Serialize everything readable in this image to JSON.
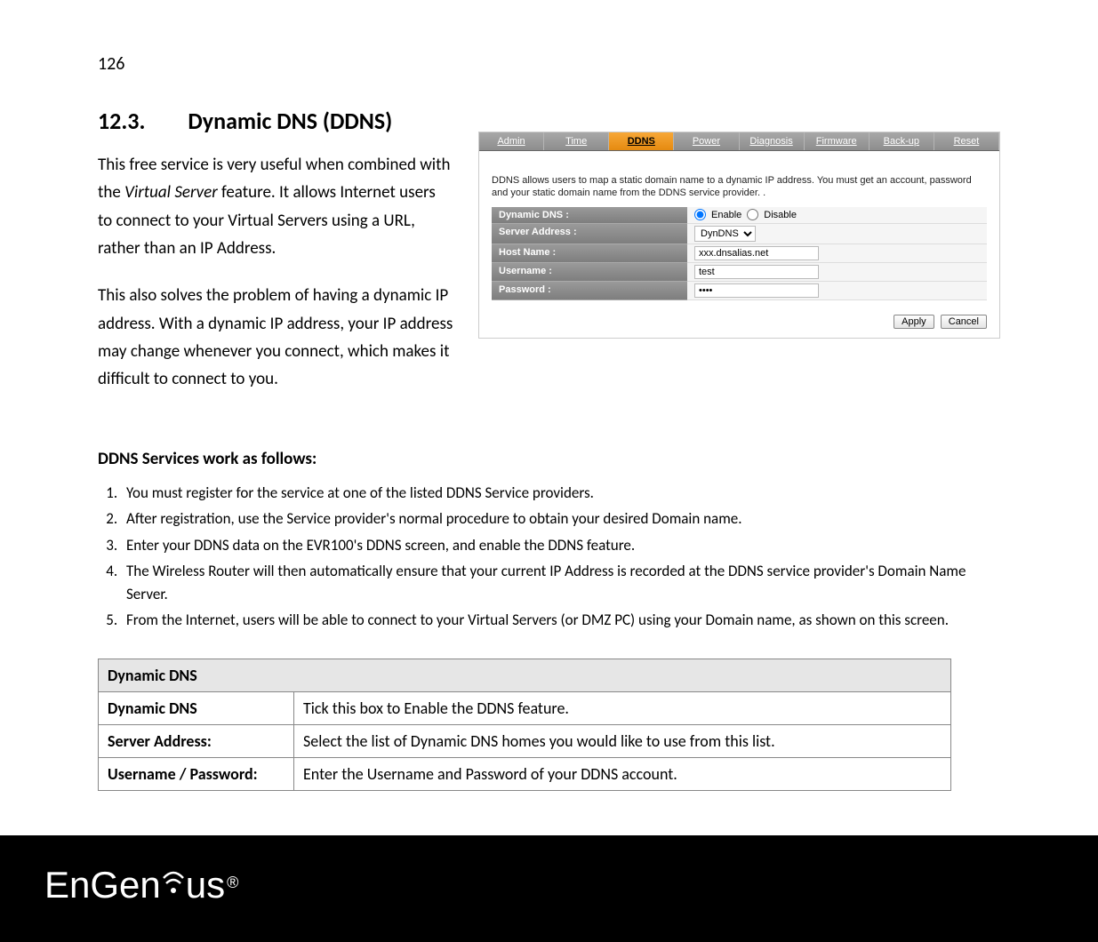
{
  "page_number": "126",
  "section": {
    "number": "12.3.",
    "title": "Dynamic DNS (DDNS)"
  },
  "paragraphs": {
    "p1_a": "This free service is very useful when combined with the ",
    "p1_ital": "Virtual Server",
    "p1_b": " feature. It allows Internet users to connect to your Virtual Servers using a URL, rather than an IP Address.",
    "p2": "This also solves the problem of having a dynamic IP address. With a dynamic IP address, your IP address may change whenever you connect, which makes it difficult to connect to you."
  },
  "router": {
    "tabs": [
      "Admin",
      "Time",
      "DDNS",
      "Power",
      "Diagnosis",
      "Firmware",
      "Back-up",
      "Reset"
    ],
    "active_tab_index": 2,
    "desc": "DDNS allows users to map a static domain name to a dynamic IP address. You must get an account, password and your static domain name from the DDNS service provider. .",
    "rows": {
      "dyn_label": "Dynamic DNS :",
      "enable": "Enable",
      "disable": "Disable",
      "server_label": "Server Address :",
      "server_value": "DynDNS",
      "host_label": "Host Name :",
      "host_value": "xxx.dnsalias.net",
      "user_label": "Username :",
      "user_value": "test",
      "pass_label": "Password :",
      "pass_value": "••••"
    },
    "apply": "Apply",
    "cancel": "Cancel"
  },
  "steps_title": "DDNS Services work as follows:",
  "steps": [
    "You must register for the service at one of the listed DDNS Service providers.",
    "After registration, use the Service provider's normal procedure to obtain your desired Domain name.",
    "Enter your DDNS data on the EVR100's DDNS screen, and enable the DDNS feature.",
    "The Wireless Router will then automatically ensure that your current IP Address is recorded at the DDNS service provider's Domain Name Server.",
    "From the Internet, users will be able to connect to your Virtual Servers (or DMZ PC) using your Domain name, as shown on this screen."
  ],
  "table": {
    "header": "Dynamic DNS",
    "rows": [
      {
        "label": "Dynamic DNS",
        "desc": "Tick this box to Enable the DDNS feature."
      },
      {
        "label": "Server Address:",
        "desc": "Select the list of Dynamic DNS homes you would like to use from this list."
      },
      {
        "label": "Username / Password:",
        "desc": "Enter the Username and Password of your DDNS account."
      }
    ]
  },
  "logo": {
    "text_a": "En",
    "text_b": "Gen",
    "text_c": "us",
    "reg": "®"
  }
}
